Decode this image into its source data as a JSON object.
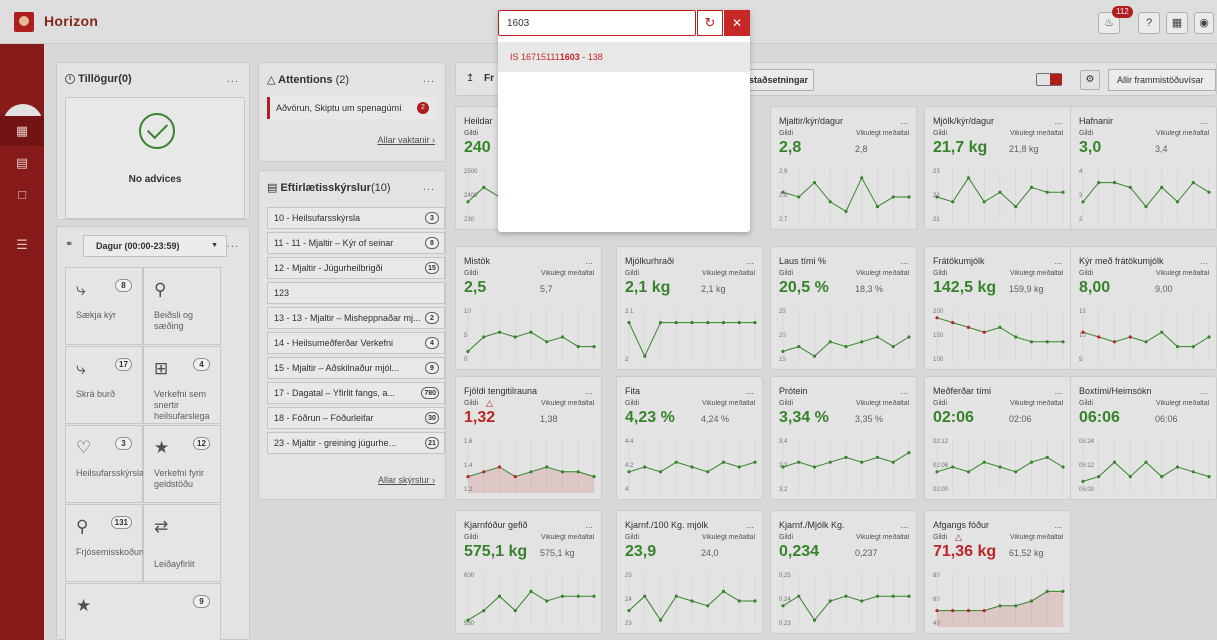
{
  "app": {
    "title": "Horizon",
    "notification_count": "112",
    "help_label": "?"
  },
  "search": {
    "value": "1603",
    "placeholder": "",
    "result_prefix": "IS 16715111",
    "result_highlight": "1603",
    "result_suffix": " - 138"
  },
  "advices": {
    "title": "Tillögur(0)",
    "empty_text": "No advices"
  },
  "shortcuts": {
    "period": "Dagur (00:00-23:59)",
    "tiles": [
      {
        "label": "Sækja kýr",
        "count": "8"
      },
      {
        "label": "Beiðsli og sæðing",
        "count": ""
      },
      {
        "label": "Skrá burð",
        "count": "17"
      },
      {
        "label": "Verkefni sem snertir heilsufarslega",
        "count": "4"
      },
      {
        "label": "Heilsufarsskýrsla",
        "count": "3"
      },
      {
        "label": "Verkefni fyrir geldstöðu",
        "count": "12"
      },
      {
        "label": "Frjósemisskoðun",
        "count": "131"
      },
      {
        "label": "Leiðayfirlit",
        "count": ""
      },
      {
        "label": "",
        "count": "9"
      }
    ]
  },
  "attentions": {
    "title": "Attentions",
    "count": "(2)",
    "item": "Aðvörun, Skiptu um spenagúmí",
    "item_count": "2",
    "link": "Allar vaktanir"
  },
  "reports": {
    "title": "Eftirlætisskýrslur",
    "count": "(10)",
    "rows": [
      {
        "label": "10 - Heilsufarsskýrsla",
        "count": "3"
      },
      {
        "label": "11 - 11 - Mjaltir – Kýr of seinar",
        "count": "8"
      },
      {
        "label": "12 - Mjaltir - Júgurheilbrigði",
        "count": "15"
      },
      {
        "label": "123",
        "count": ""
      },
      {
        "label": "13 - 13 - Mjaltir – Misheppnaðar mj...",
        "count": "2"
      },
      {
        "label": "14 - Heilsumeðferðar Verkefni",
        "count": "4"
      },
      {
        "label": "15 - Mjaltir – Aðskilnaður mjól...",
        "count": "9"
      },
      {
        "label": "17 - Dagatal – Yfirlit fangs, a...",
        "count": "780"
      },
      {
        "label": "18 - Fóðrun – Fóðurleifar",
        "count": "30"
      },
      {
        "label": "23 - Mjaltir - greining júgurhe...",
        "count": "21"
      }
    ],
    "link": "Allar skýrslur"
  },
  "performance": {
    "tab_label_partial": "Fr",
    "tab_staðsetningar": "staðsetningar",
    "all_button": "Allir frammistöðuvísar"
  },
  "kpi_labels": {
    "gildi": "Gildi",
    "vikulegt": "Vikulegt meðaltal"
  },
  "kpis": [
    {
      "title": "Heildar",
      "value": "240",
      "ref": "",
      "bad": false,
      "ticks": [
        "2500",
        "2400",
        "230"
      ],
      "points": [
        0.4,
        0.7,
        0.5,
        0.6,
        0.4,
        0.5,
        0.6,
        0.5,
        0.5
      ],
      "negative": false
    },
    {
      "title": "Mjaltir/kýr/dagur",
      "value": "2,8",
      "ref": "2,8",
      "bad": false,
      "ticks": [
        "2,9",
        "2,8",
        "2,7"
      ],
      "points": [
        0.6,
        0.5,
        0.8,
        0.4,
        0.2,
        0.9,
        0.3,
        0.5,
        0.5
      ],
      "negative": false
    },
    {
      "title": "Mjólk/kýr/dagur",
      "value": "21,7 kg",
      "ref": "21,8 kg",
      "bad": false,
      "ticks": [
        "23",
        "22",
        "21"
      ],
      "points": [
        0.5,
        0.4,
        0.9,
        0.4,
        0.6,
        0.3,
        0.7,
        0.6,
        0.6
      ],
      "negative": false
    },
    {
      "title": "Hafnanir",
      "value": "3,0",
      "ref": "3,4",
      "bad": false,
      "ticks": [
        "4",
        "3",
        "2"
      ],
      "points": [
        0.4,
        0.8,
        0.8,
        0.7,
        0.3,
        0.7,
        0.4,
        0.8,
        0.6
      ],
      "negative": false
    },
    {
      "title": "Mistök",
      "value": "2,5",
      "ref": "5,7",
      "bad": false,
      "ticks": [
        "10",
        "5",
        "0"
      ],
      "points": [
        0.2,
        0.5,
        0.6,
        0.5,
        0.6,
        0.4,
        0.5,
        0.3,
        0.3
      ],
      "negative": false
    },
    {
      "title": "Mjólkurhraði",
      "value": "2,1 kg",
      "ref": "2,1 kg",
      "bad": false,
      "ticks": [
        "2,1",
        "2"
      ],
      "points": [
        0.8,
        0.1,
        0.8,
        0.8,
        0.8,
        0.8,
        0.8,
        0.8,
        0.8
      ],
      "negative": false
    },
    {
      "title": "Laus tími %",
      "value": "20,5 %",
      "ref": "18,3 %",
      "bad": false,
      "ticks": [
        "25",
        "20",
        "15"
      ],
      "points": [
        0.2,
        0.3,
        0.1,
        0.4,
        0.3,
        0.4,
        0.5,
        0.3,
        0.5
      ],
      "negative": false
    },
    {
      "title": "Frátökumjólk",
      "value": "142,5 kg",
      "ref": "159,9 kg",
      "bad": false,
      "ticks": [
        "200",
        "150",
        "100"
      ],
      "points": [
        0.9,
        0.8,
        0.7,
        0.6,
        0.7,
        0.5,
        0.4,
        0.4,
        0.4
      ],
      "negative": true
    },
    {
      "title": "Kýr með frátökumjólk",
      "value": "8,00",
      "ref": "9,00",
      "bad": false,
      "ticks": [
        "15",
        "10",
        "5"
      ],
      "points": [
        0.6,
        0.5,
        0.4,
        0.5,
        0.4,
        0.6,
        0.3,
        0.3,
        0.5
      ],
      "negative": true
    },
    {
      "title": "Fjöldi tengitilrauna",
      "value": "1,32",
      "ref": "1,38",
      "bad": true,
      "ticks": [
        "1,6",
        "1,4",
        "1,2"
      ],
      "points": [
        0.3,
        0.4,
        0.5,
        0.3,
        0.4,
        0.5,
        0.4,
        0.4,
        0.3
      ],
      "negative": true
    },
    {
      "title": "Fita",
      "value": "4,23 %",
      "ref": "4,24 %",
      "bad": false,
      "ticks": [
        "4,4",
        "4,2",
        "4"
      ],
      "points": [
        0.4,
        0.5,
        0.4,
        0.6,
        0.5,
        0.4,
        0.6,
        0.5,
        0.6
      ],
      "negative": false
    },
    {
      "title": "Prótein",
      "value": "3,34 %",
      "ref": "3,35 %",
      "bad": false,
      "ticks": [
        "3,4",
        "3,3",
        "3,2"
      ],
      "points": [
        0.5,
        0.6,
        0.5,
        0.6,
        0.7,
        0.6,
        0.7,
        0.6,
        0.8
      ],
      "negative": false
    },
    {
      "title": "Meðferðar tími",
      "value": "02:06",
      "ref": "02:06",
      "bad": false,
      "ticks": [
        "02:12",
        "02:06",
        "02:00"
      ],
      "points": [
        0.4,
        0.5,
        0.4,
        0.6,
        0.5,
        0.4,
        0.6,
        0.7,
        0.5
      ],
      "negative": false
    },
    {
      "title": "Boxtími/Heimsókn",
      "value": "06:06",
      "ref": "06:06",
      "bad": false,
      "ticks": [
        "06:24",
        "06:12",
        "06:00"
      ],
      "points": [
        0.2,
        0.3,
        0.6,
        0.3,
        0.6,
        0.3,
        0.5,
        0.4,
        0.3
      ],
      "negative": false
    },
    {
      "title": "Kjarnfóður gefið",
      "value": "575,1 kg",
      "ref": "575,1 kg",
      "bad": false,
      "ticks": [
        "600",
        "550"
      ],
      "points": [
        0.1,
        0.3,
        0.6,
        0.3,
        0.7,
        0.5,
        0.6,
        0.6,
        0.6
      ],
      "negative": false
    },
    {
      "title": "Kjarnf./100 Kg. mjólk",
      "value": "23,9",
      "ref": "24,0",
      "bad": false,
      "ticks": [
        "25",
        "24",
        "23"
      ],
      "points": [
        0.3,
        0.6,
        0.1,
        0.6,
        0.5,
        0.4,
        0.7,
        0.5,
        0.5
      ],
      "negative": false
    },
    {
      "title": "Kjarnf./Mjólk Kg.",
      "value": "0,234",
      "ref": "0,237",
      "bad": false,
      "ticks": [
        "0,25",
        "0,24",
        "0,23"
      ],
      "points": [
        0.4,
        0.6,
        0.1,
        0.5,
        0.6,
        0.5,
        0.6,
        0.6,
        0.6
      ],
      "negative": false
    },
    {
      "title": "Afgangs fóður",
      "value": "71,36 kg",
      "ref": "61,52 kg",
      "bad": true,
      "ticks": [
        "80",
        "60",
        "40"
      ],
      "points": [
        0.3,
        0.3,
        0.3,
        0.3,
        0.4,
        0.4,
        0.5,
        0.7,
        0.7
      ],
      "negative": true
    }
  ],
  "colors": {
    "brand": "#8f1d1c",
    "good": "#3b8c2f",
    "bad": "#c62828"
  }
}
